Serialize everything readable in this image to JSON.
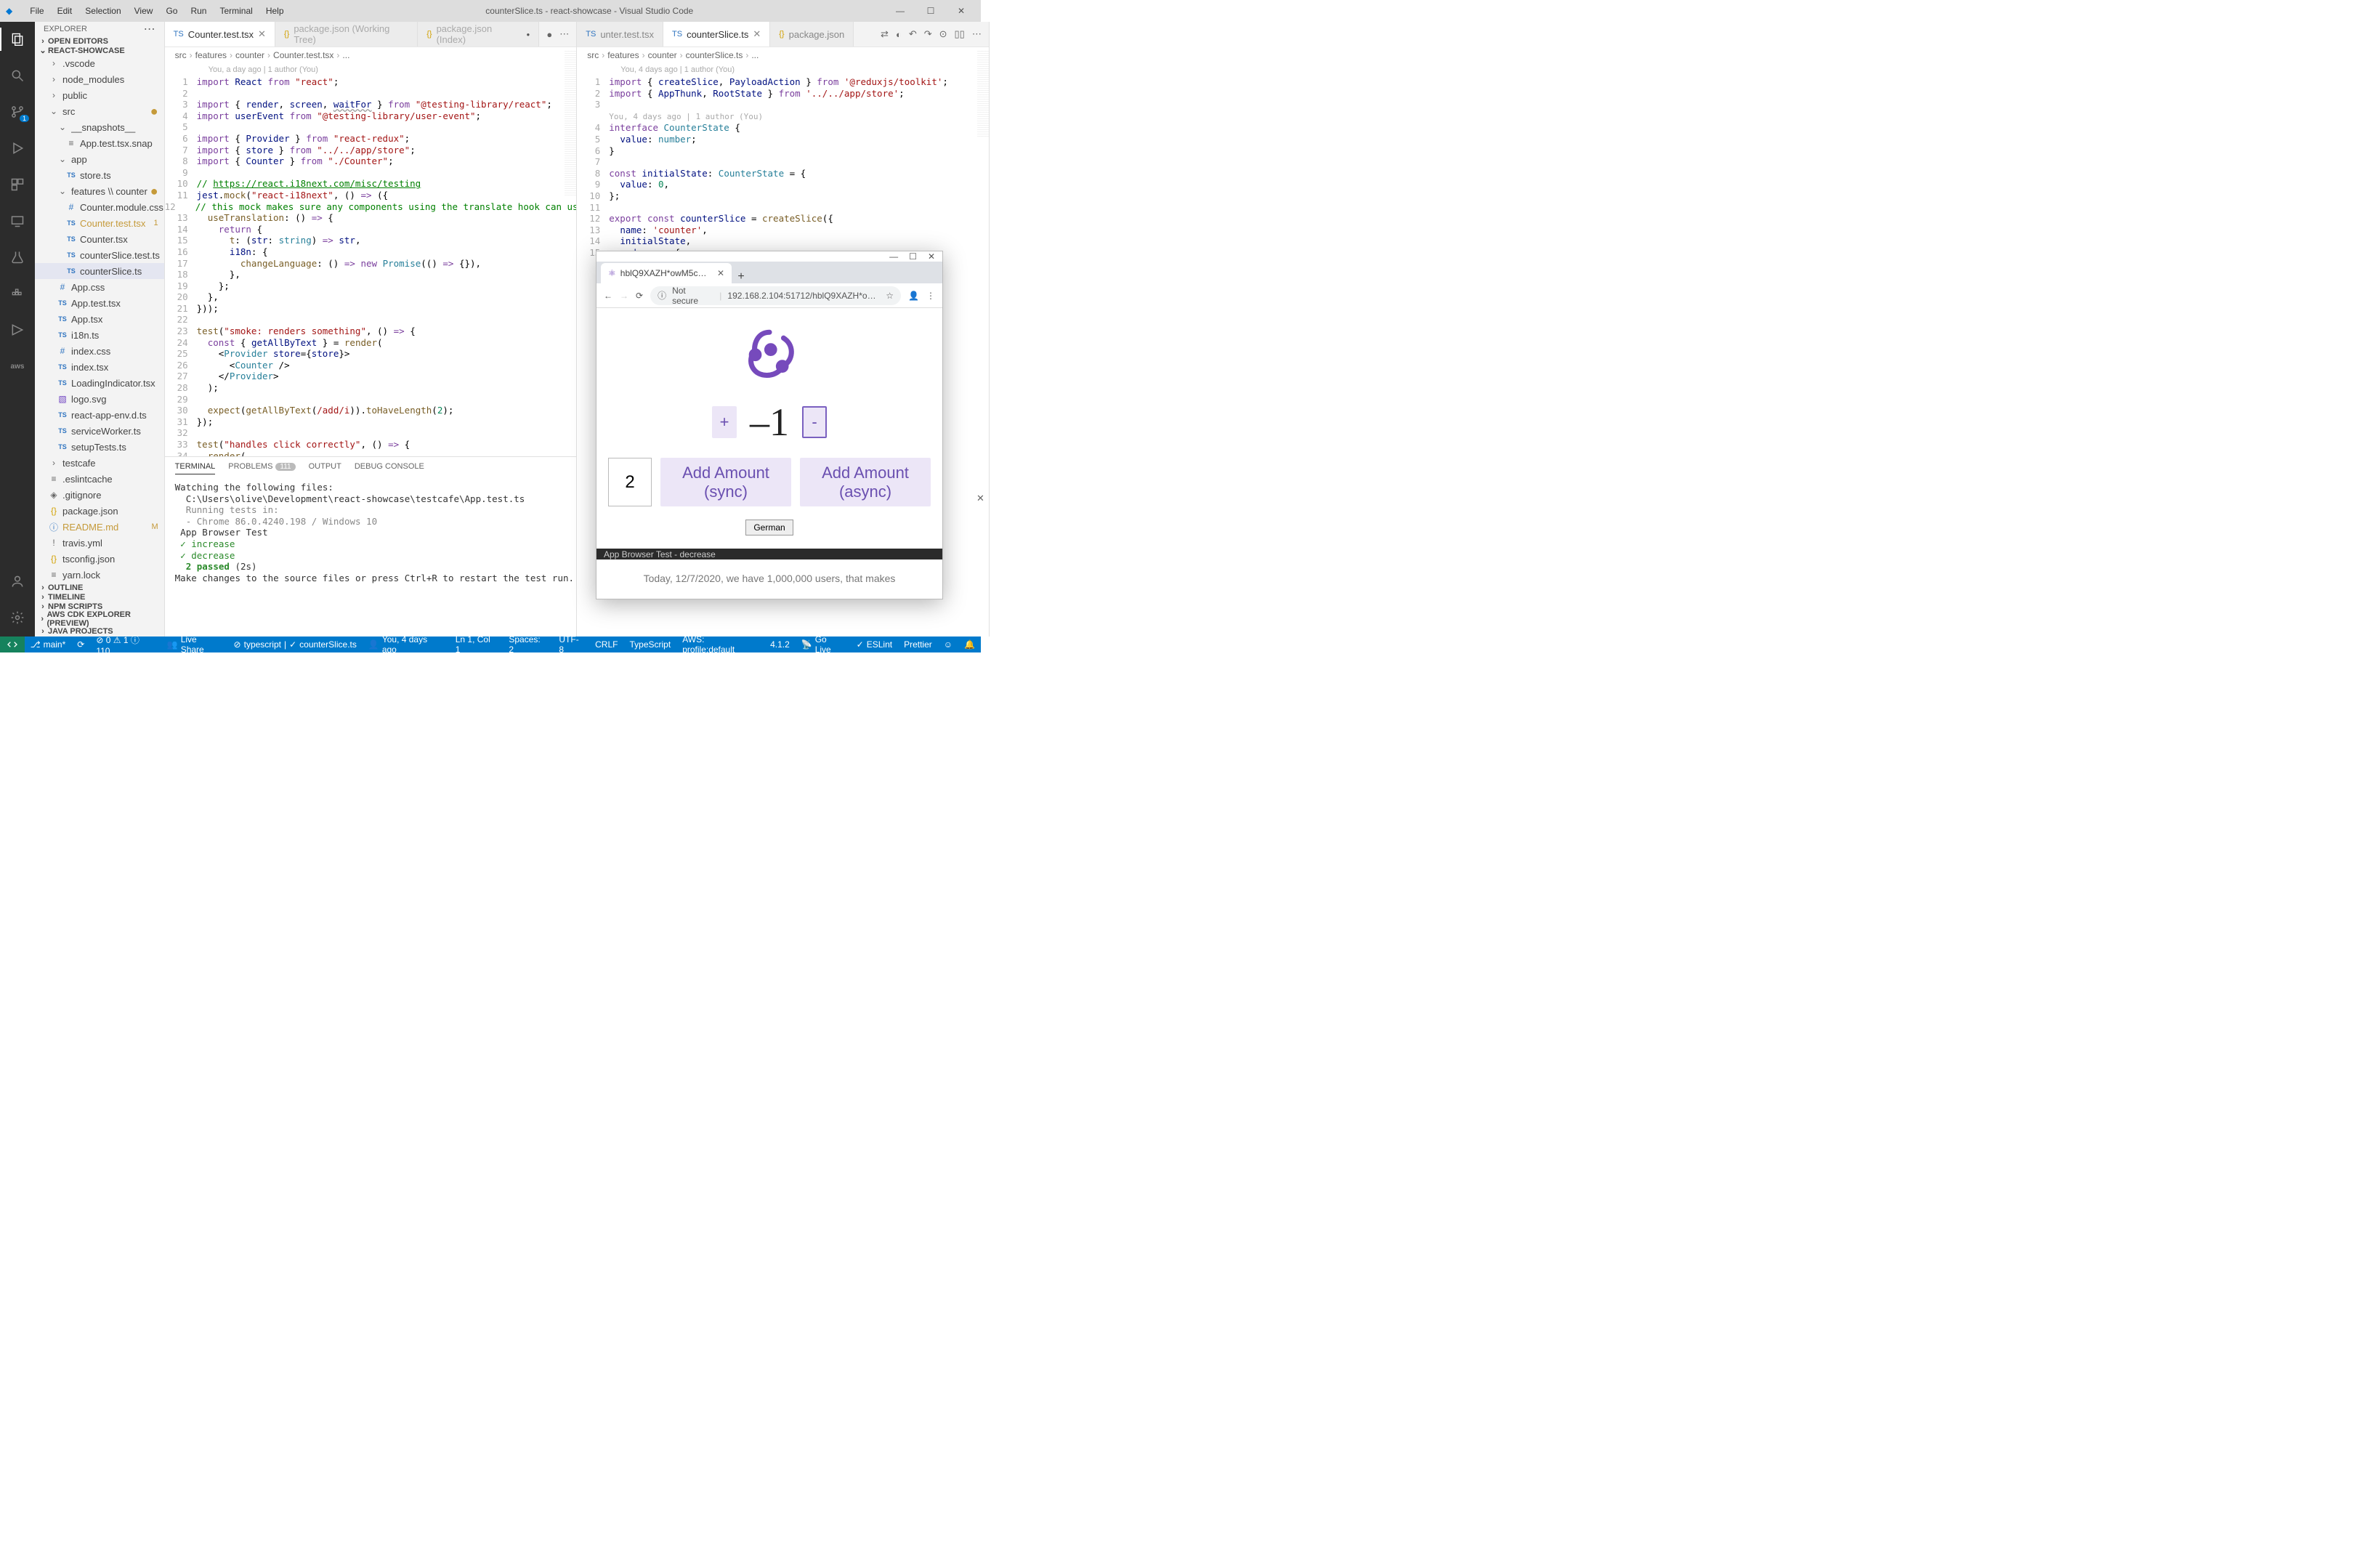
{
  "titlebar": {
    "menus": [
      "File",
      "Edit",
      "Selection",
      "View",
      "Go",
      "Run",
      "Terminal",
      "Help"
    ],
    "title": "counterSlice.ts - react-showcase - Visual Studio Code"
  },
  "activitybar": {
    "scm_badge": "1"
  },
  "sidebar": {
    "title": "EXPLORER",
    "open_editors": "OPEN EDITORS",
    "workspace": "REACT-SHOWCASE",
    "outline": "OUTLINE",
    "timeline": "TIMELINE",
    "npm": "NPM SCRIPTS",
    "awscdk": "AWS CDK EXPLORER (PREVIEW)",
    "java": "JAVA PROJECTS",
    "tree": [
      {
        "depth": 0,
        "kind": "folder",
        "open": false,
        "label": ".vscode"
      },
      {
        "depth": 0,
        "kind": "folder",
        "open": false,
        "label": "node_modules"
      },
      {
        "depth": 0,
        "kind": "folder",
        "open": false,
        "label": "public"
      },
      {
        "depth": 0,
        "kind": "folder",
        "open": true,
        "label": "src",
        "dot": true
      },
      {
        "depth": 1,
        "kind": "folder",
        "open": true,
        "label": "__snapshots__"
      },
      {
        "depth": 2,
        "kind": "file",
        "ic": "file",
        "label": "App.test.tsx.snap"
      },
      {
        "depth": 1,
        "kind": "folder",
        "open": true,
        "label": "app"
      },
      {
        "depth": 2,
        "kind": "file",
        "ic": "ts",
        "label": "store.ts"
      },
      {
        "depth": 1,
        "kind": "folder",
        "open": true,
        "label": "features \\\\ counter",
        "dot": true
      },
      {
        "depth": 2,
        "kind": "file",
        "ic": "css",
        "label": "Counter.module.css"
      },
      {
        "depth": 2,
        "kind": "file",
        "ic": "ts",
        "label": "Counter.test.tsx",
        "mod": true,
        "right": "1"
      },
      {
        "depth": 2,
        "kind": "file",
        "ic": "ts",
        "label": "Counter.tsx"
      },
      {
        "depth": 2,
        "kind": "file",
        "ic": "ts",
        "label": "counterSlice.test.ts"
      },
      {
        "depth": 2,
        "kind": "file",
        "ic": "ts",
        "label": "counterSlice.ts",
        "sel": true
      },
      {
        "depth": 1,
        "kind": "file",
        "ic": "css",
        "label": "App.css"
      },
      {
        "depth": 1,
        "kind": "file",
        "ic": "ts",
        "label": "App.test.tsx"
      },
      {
        "depth": 1,
        "kind": "file",
        "ic": "ts",
        "label": "App.tsx"
      },
      {
        "depth": 1,
        "kind": "file",
        "ic": "ts",
        "label": "i18n.ts"
      },
      {
        "depth": 1,
        "kind": "file",
        "ic": "css",
        "label": "index.css"
      },
      {
        "depth": 1,
        "kind": "file",
        "ic": "ts",
        "label": "index.tsx"
      },
      {
        "depth": 1,
        "kind": "file",
        "ic": "ts",
        "label": "LoadingIndicator.tsx"
      },
      {
        "depth": 1,
        "kind": "file",
        "ic": "svg",
        "label": "logo.svg"
      },
      {
        "depth": 1,
        "kind": "file",
        "ic": "ts",
        "label": "react-app-env.d.ts"
      },
      {
        "depth": 1,
        "kind": "file",
        "ic": "ts",
        "label": "serviceWorker.ts"
      },
      {
        "depth": 1,
        "kind": "file",
        "ic": "ts",
        "label": "setupTests.ts"
      },
      {
        "depth": 0,
        "kind": "folder",
        "open": false,
        "label": "testcafe"
      },
      {
        "depth": 0,
        "kind": "file",
        "ic": "file",
        "label": ".eslintcache"
      },
      {
        "depth": 0,
        "kind": "file",
        "ic": "git",
        "label": ".gitignore"
      },
      {
        "depth": 0,
        "kind": "file",
        "ic": "json",
        "label": "package.json"
      },
      {
        "depth": 0,
        "kind": "file",
        "ic": "md",
        "label": "README.md",
        "mod": true,
        "right": "M"
      },
      {
        "depth": 0,
        "kind": "file",
        "ic": "yml",
        "label": "travis.yml"
      },
      {
        "depth": 0,
        "kind": "file",
        "ic": "json",
        "label": "tsconfig.json"
      },
      {
        "depth": 0,
        "kind": "file",
        "ic": "file",
        "label": "yarn.lock"
      }
    ]
  },
  "tabs_left": [
    {
      "icon": "ts",
      "label": "Counter.test.tsx",
      "active": true,
      "close": true
    },
    {
      "icon": "json",
      "label": "package.json (Working Tree)",
      "dim": true
    },
    {
      "icon": "json",
      "label": "package.json (Index)",
      "dim": true,
      "mod": true
    }
  ],
  "tabs_right": [
    {
      "icon": "ts",
      "label": "unter.test.tsx",
      "clipped": true
    },
    {
      "icon": "ts",
      "label": "counterSlice.ts",
      "active": true,
      "close": true
    },
    {
      "icon": "json",
      "label": "package.json"
    }
  ],
  "breadcrumb_left": [
    "src",
    "features",
    "counter",
    "Counter.test.tsx",
    "..."
  ],
  "breadcrumb_right": [
    "src",
    "features",
    "counter",
    "counterSlice.ts",
    "..."
  ],
  "blame_left": "You, a day ago | 1 author (You)",
  "blame_right": "You, 4 days ago | 1 author (You)",
  "blame_right_inner": "You, 4 days ago | 1 author (You)",
  "code_left": [
    {
      "n": 1,
      "h": "<span class='tk-kw'>import</span> <span class='tk-var'>React</span> <span class='tk-kw'>from</span> <span class='tk-str'>\"react\"</span>;"
    },
    {
      "n": 2,
      "h": ""
    },
    {
      "n": 3,
      "h": "<span class='tk-kw'>import</span> { <span class='tk-var'>render</span>, <span class='tk-var'>screen</span>, <span class='tk-var' style='text-decoration:underline wavy #999'>waitFor</span> } <span class='tk-kw'>from</span> <span class='tk-str'>\"@testing-library/react\"</span>;"
    },
    {
      "n": 4,
      "h": "<span class='tk-kw'>import</span> <span class='tk-var'>userEvent</span> <span class='tk-kw'>from</span> <span class='tk-str'>\"@testing-library/user-event\"</span>;"
    },
    {
      "n": 5,
      "h": ""
    },
    {
      "n": 6,
      "h": "<span class='tk-kw'>import</span> { <span class='tk-var'>Provider</span> } <span class='tk-kw'>from</span> <span class='tk-str'>\"react-redux\"</span>;"
    },
    {
      "n": 7,
      "h": "<span class='tk-kw'>import</span> { <span class='tk-var'>store</span> } <span class='tk-kw'>from</span> <span class='tk-str'>\"../../app/store\"</span>;"
    },
    {
      "n": 8,
      "h": "<span class='tk-kw'>import</span> { <span class='tk-var'>Counter</span> } <span class='tk-kw'>from</span> <span class='tk-str'>\"./Counter\"</span>;"
    },
    {
      "n": 9,
      "h": ""
    },
    {
      "n": 10,
      "h": "<span class='tk-cm'>// </span><span class='tk-url'>https://react.i18next.com/misc/testing</span>"
    },
    {
      "n": 11,
      "h": "<span class='tk-var'>jest</span>.<span class='tk-fn'>mock</span>(<span class='tk-str'>\"react-i18next\"</span>, () <span class='tk-kw'>=&gt;</span> ({"
    },
    {
      "n": 12,
      "h": "  <span class='tk-cm'>// this mock makes sure any components using the translate hook can use</span>"
    },
    {
      "n": 13,
      "h": "  <span class='tk-fn'>useTranslation</span>: () <span class='tk-kw'>=&gt;</span> {"
    },
    {
      "n": 14,
      "h": "    <span class='tk-kw'>return</span> {"
    },
    {
      "n": 15,
      "h": "      <span class='tk-fn'>t</span>: (<span class='tk-var'>str</span>: <span class='tk-type'>string</span>) <span class='tk-kw'>=&gt;</span> <span class='tk-var'>str</span>,"
    },
    {
      "n": 16,
      "h": "      <span class='tk-var'>i18n</span>: {"
    },
    {
      "n": 17,
      "h": "        <span class='tk-fn'>changeLanguage</span>: () <span class='tk-kw'>=&gt;</span> <span class='tk-kw'>new</span> <span class='tk-type'>Promise</span>(() <span class='tk-kw'>=&gt;</span> {}),"
    },
    {
      "n": 18,
      "h": "      },"
    },
    {
      "n": 19,
      "h": "    };"
    },
    {
      "n": 20,
      "h": "  },"
    },
    {
      "n": 21,
      "h": "}));"
    },
    {
      "n": 22,
      "h": ""
    },
    {
      "n": 23,
      "h": "<span class='tk-fn'>test</span>(<span class='tk-str'>\"smoke: renders something\"</span>, () <span class='tk-kw'>=&gt;</span> {"
    },
    {
      "n": 24,
      "h": "  <span class='tk-kw'>const</span> { <span class='tk-var'>getAllByText</span> } = <span class='tk-fn'>render</span>("
    },
    {
      "n": 25,
      "h": "    &lt;<span class='tk-type'>Provider</span> <span class='tk-var'>store</span>={<span class='tk-var'>store</span>}&gt;"
    },
    {
      "n": 26,
      "h": "      &lt;<span class='tk-type'>Counter</span> /&gt;"
    },
    {
      "n": 27,
      "h": "    &lt;/<span class='tk-type'>Provider</span>&gt;"
    },
    {
      "n": 28,
      "h": "  );"
    },
    {
      "n": 29,
      "h": ""
    },
    {
      "n": 30,
      "h": "  <span class='tk-fn'>expect</span>(<span class='tk-fn'>getAllByText</span>(<span class='tk-str'>/add/i</span>)).<span class='tk-fn'>toHaveLength</span>(<span class='tk-num'>2</span>);"
    },
    {
      "n": 31,
      "h": "});"
    },
    {
      "n": 32,
      "h": ""
    },
    {
      "n": 33,
      "h": "<span class='tk-fn'>test</span>(<span class='tk-str'>\"handles click correctly\"</span>, () <span class='tk-kw'>=&gt;</span> {"
    },
    {
      "n": 34,
      "h": "  <span class='tk-fn'>render</span>("
    }
  ],
  "code_right": [
    {
      "n": 1,
      "h": "<span class='tk-kw'>import</span> { <span class='tk-var'>createSlice</span>, <span class='tk-var'>PayloadAction</span> } <span class='tk-kw'>from</span> <span class='tk-str'>'@reduxjs/toolkit'</span>;"
    },
    {
      "n": 2,
      "h": "<span class='tk-kw'>import</span> { <span class='tk-var'>AppThunk</span>, <span class='tk-var'>RootState</span> } <span class='tk-kw'>from</span> <span class='tk-str'>'../../app/store'</span>;"
    },
    {
      "n": 3,
      "h": ""
    },
    {
      "n": "",
      "h": "<span style='color:#aaa;font-size:11px'>You, 4 days ago | 1 author (You)</span>"
    },
    {
      "n": 4,
      "h": "<span class='tk-kw'>interface</span> <span class='tk-type'>CounterState</span> {"
    },
    {
      "n": 5,
      "h": "  <span class='tk-var'>value</span>: <span class='tk-type'>number</span>;"
    },
    {
      "n": 6,
      "h": "}"
    },
    {
      "n": 7,
      "h": ""
    },
    {
      "n": 8,
      "h": "<span class='tk-kw'>const</span> <span class='tk-var'>initialState</span>: <span class='tk-type'>CounterState</span> = {"
    },
    {
      "n": 9,
      "h": "  <span class='tk-var'>value</span>: <span class='tk-num'>0</span>,"
    },
    {
      "n": 10,
      "h": "};"
    },
    {
      "n": 11,
      "h": ""
    },
    {
      "n": 12,
      "h": "<span class='tk-kw'>export</span> <span class='tk-kw'>const</span> <span class='tk-var'>counterSlice</span> = <span class='tk-fn'>createSlice</span>({"
    },
    {
      "n": 13,
      "h": "  <span class='tk-var'>name</span>: <span class='tk-str'>'counter'</span>,"
    },
    {
      "n": 14,
      "h": "  <span class='tk-var'>initialState</span>,"
    },
    {
      "n": 15,
      "h": "  <span class='tk-var'>reducers</span>: {"
    }
  ],
  "terminal": {
    "tabs": {
      "terminal": "TERMINAL",
      "problems": "PROBLEMS",
      "problems_count": "111",
      "output": "OUTPUT",
      "debug": "DEBUG CONSOLE"
    },
    "lines": [
      {
        "t": "Watching the following files:"
      },
      {
        "t": "  C:\\Users\\olive\\Development\\react-showcase\\testcafe\\App.test.ts"
      },
      {
        "t": "  Running tests in:",
        "cls": "dim"
      },
      {
        "t": "  - Chrome 86.0.4240.198 / Windows 10",
        "cls": "dim"
      },
      {
        "t": ""
      },
      {
        "t": " App Browser Test"
      },
      {
        "t": " ✓ increase",
        "cls": "ok"
      },
      {
        "t": " ✓ decrease",
        "cls": "ok"
      },
      {
        "t": ""
      },
      {
        "t": ""
      },
      {
        "t": " 2 passed (2s)",
        "cls": "okb",
        "mix": " (2s)"
      },
      {
        "t": ""
      },
      {
        "t": "Make changes to the source files or press Ctrl+R to restart the test run."
      }
    ]
  },
  "statusbar": {
    "branch": "main*",
    "sync": "⟳",
    "errors": "⊘ 0 ⚠ 1 ⓘ 110",
    "live": "Live Share",
    "lang": "typescript",
    "check": "✓",
    "file": "counterSlice.ts",
    "blame": "You, 4 days ago",
    "pos": "Ln 1, Col 1",
    "spaces": "Spaces: 2",
    "enc": "UTF-8",
    "eol": "CRLF",
    "mode": "TypeScript",
    "aws": "AWS: profile:default",
    "ver": "4.1.2",
    "golive": "Go Live",
    "eslint": "ESLint",
    "prettier": "Prettier"
  },
  "browser": {
    "wintitle": "",
    "tab": "hblQ9XAZH*owM5cq5f1",
    "not_secure": "Not secure",
    "url": "192.168.2.104:51712/hblQ9XAZH*ow…",
    "counter": "–1",
    "amount": "2",
    "add_sync": "Add Amount (sync)",
    "add_async": "Add Amount (async)",
    "lang": "German",
    "teststatus": "App Browser Test - decrease",
    "extratext": "Today, 12/7/2020, we have 1,000,000 users, that makes"
  }
}
